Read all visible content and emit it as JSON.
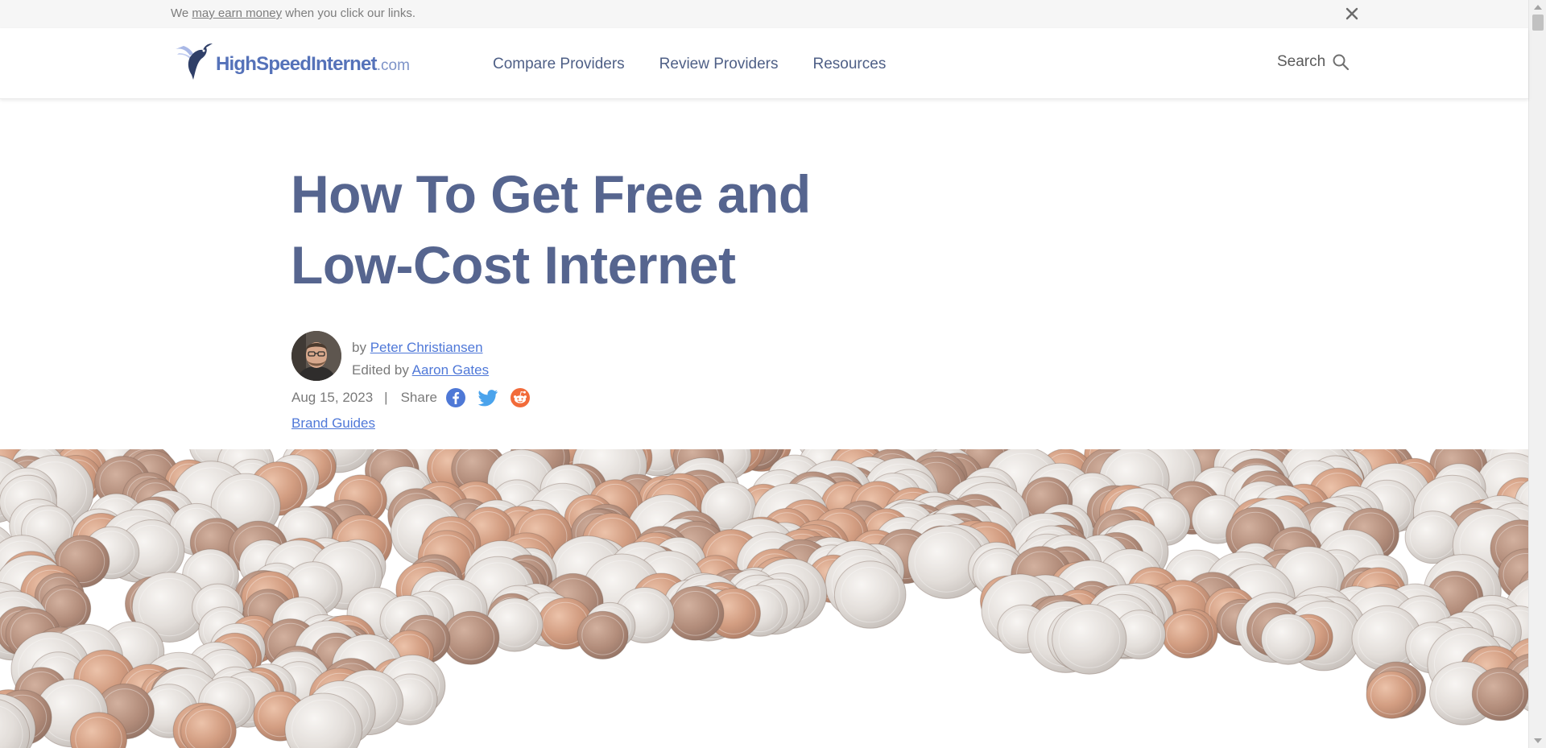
{
  "disclosure": {
    "prefix": "We ",
    "link_text": "may earn money",
    "suffix": " when you click our links."
  },
  "header": {
    "logo": {
      "name": "HighSpeedInternet",
      "tld": ".com",
      "icon": "hummingbird-logo-icon"
    },
    "nav": [
      {
        "label": "Compare Providers"
      },
      {
        "label": "Review Providers"
      },
      {
        "label": "Resources"
      }
    ],
    "search": {
      "label": "Search",
      "icon": "search-icon"
    }
  },
  "article": {
    "title_line1": "How To Get Free and",
    "title_line2": "Low-Cost Internet",
    "byline": {
      "by_prefix": "by ",
      "author": "Peter Christiansen",
      "edited_prefix": "Edited by ",
      "editor": "Aaron Gates"
    },
    "date": "Aug 15, 2023",
    "separator": "|",
    "share_label": "Share",
    "share_icons": [
      "facebook-icon",
      "twitter-icon",
      "reddit-icon"
    ],
    "category": "Brand Guides"
  },
  "colors": {
    "brand": "#5572b9",
    "title": "#56658f",
    "link": "#4f78d8",
    "facebook": "#4e78d6",
    "twitter": "#4aa3ec",
    "reddit": "#f26b3a"
  }
}
